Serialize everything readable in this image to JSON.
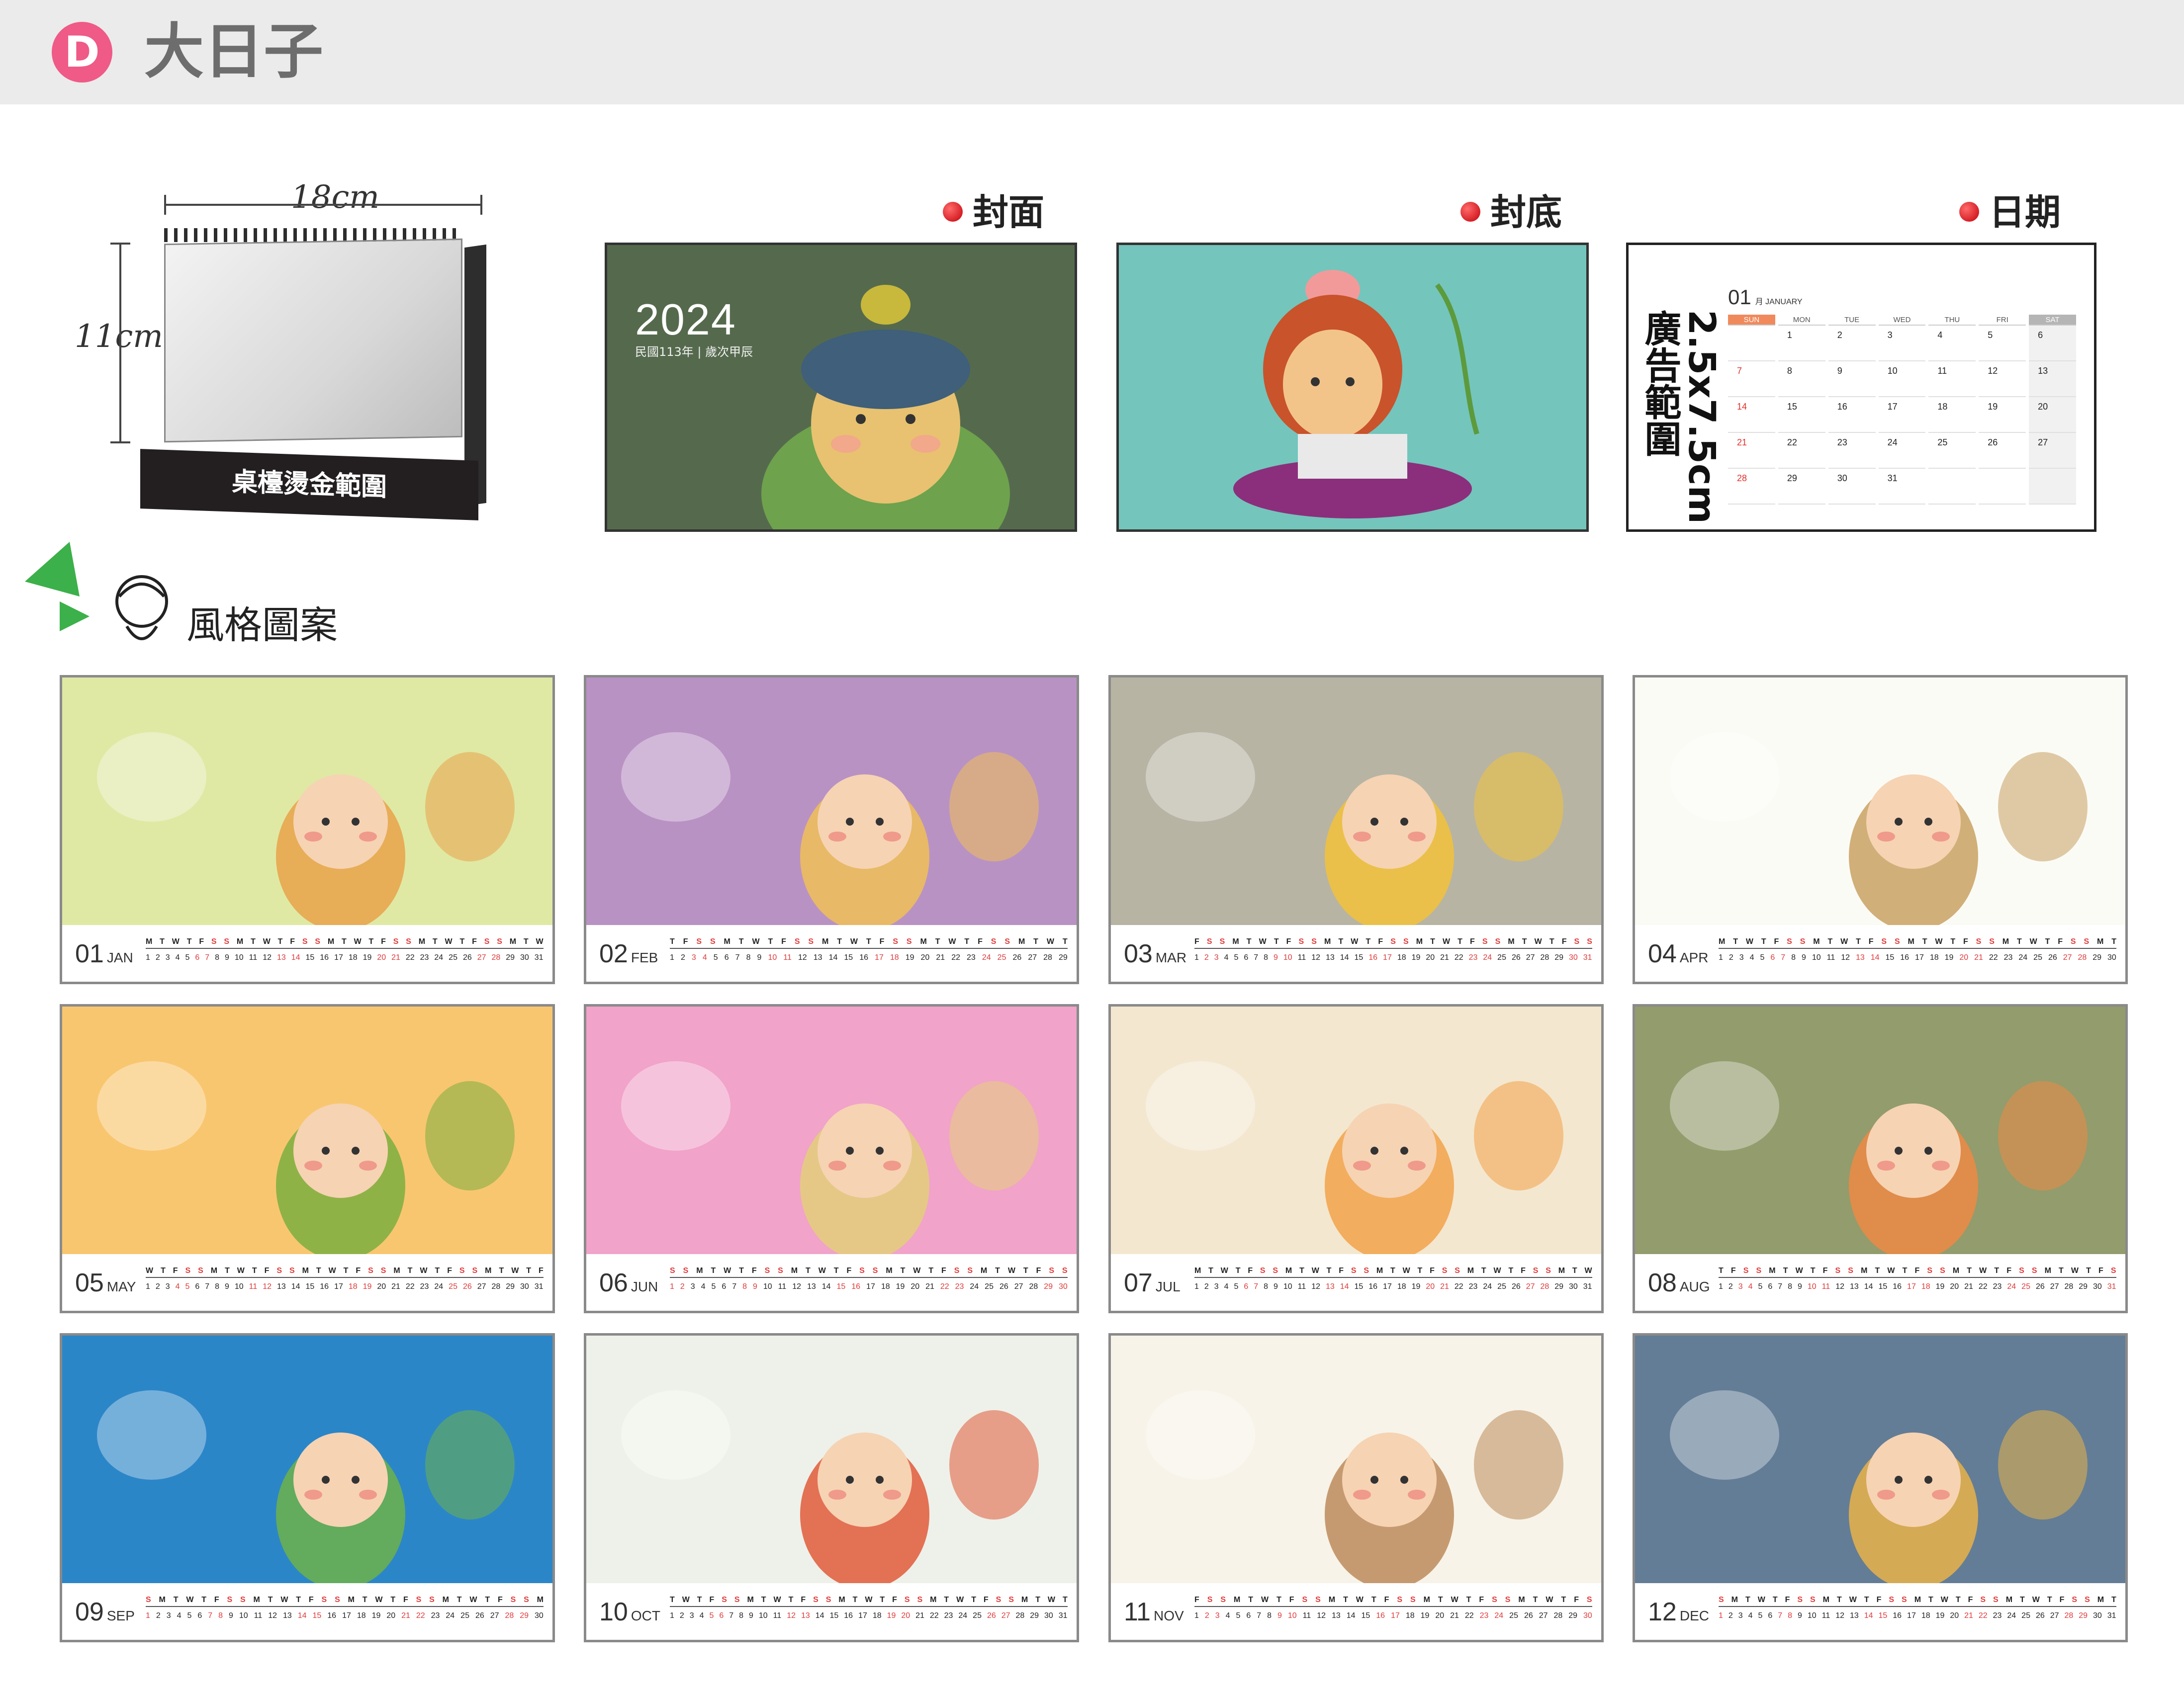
{
  "header": {
    "badge": "D",
    "title": "大日子"
  },
  "desk": {
    "width_label": "18cm",
    "height_label": "11cm",
    "base_label": "桌檯燙金範圍"
  },
  "previews": {
    "cover": {
      "label": "封面",
      "year": "2024",
      "subtitle": "民國113年 | 歲次甲辰",
      "bg": "#556a4d"
    },
    "back": {
      "label": "封底",
      "bg": "#74c5bc"
    },
    "date": {
      "label": "日期",
      "ad_size": "2.5x7.5cm",
      "ad_label": "廣告範圍",
      "month_num": "01",
      "month_name": "月 JANUARY",
      "weekdays": [
        "SUN",
        "MON",
        "TUE",
        "WED",
        "THU",
        "FRI",
        "SAT"
      ],
      "days": [
        "",
        "1",
        "2",
        "3",
        "4",
        "5",
        "6",
        "7",
        "8",
        "9",
        "10",
        "11",
        "12",
        "13",
        "14",
        "15",
        "16",
        "17",
        "18",
        "19",
        "20",
        "21",
        "22",
        "23",
        "24",
        "25",
        "26",
        "27",
        "28",
        "29",
        "30",
        "31",
        "",
        "",
        ""
      ]
    }
  },
  "style": {
    "title": "風格圖案"
  },
  "months": [
    {
      "num": "01",
      "abbr": "JAN",
      "bg": "#dfe9a4",
      "art": "#e9a24a",
      "weekdays": "M T W T F S S M T W T F S S M T W T F S S M T W T F S S M T W",
      "days": "1 2 3 4 5 6 7 8 9 10 11 12 13 14 15 16 17 18 19 20 21 22 23 24 25 26 27 28 29 30 31"
    },
    {
      "num": "02",
      "abbr": "FEB",
      "bg": "#b992c4",
      "art": "#f0c057",
      "weekdays": "T F S S M T W T F S S M T W T F S S M T W T F S S M T W T",
      "days": "1 2 3 4 5 6 7 8 9 10 11 12 13 14 15 16 17 18 19 20 21 22 23 24 25 26 27 28 29"
    },
    {
      "num": "03",
      "abbr": "MAR",
      "bg": "#b7b4a4",
      "art": "#f3c23b",
      "weekdays": "F S S M T W T F S S M T W T F S S M T W T F S S M T W T F S S",
      "days": "1 2 3 4 5 6 7 8 9 10 11 12 13 14 15 16 17 18 19 20 21 22 23 24 25 26 27 28 29 30 31"
    },
    {
      "num": "04",
      "abbr": "APR",
      "bg": "#fbfbf6",
      "art": "#c9a162",
      "weekdays": "M T W T F S S M T W T F S S M T W T F S S M T W T F S S M T",
      "days": "1 2 3 4 5 6 7 8 9 10 11 12 13 14 15 16 17 18 19 20 21 22 23 24 25 26 27 28 29 30"
    },
    {
      "num": "05",
      "abbr": "MAY",
      "bg": "#f9c670",
      "art": "#7cae3f",
      "weekdays": "W T F S S M T W T F S S M T W T F S S M T W T F S S M T W T F",
      "days": "1 2 3 4 5 6 7 8 9 10 11 12 13 14 15 16 17 18 19 20 21 22 23 24 25 26 27 28 29 30 31"
    },
    {
      "num": "06",
      "abbr": "JUN",
      "bg": "#f1a3c9",
      "art": "#e3cf7a",
      "weekdays": "S S M T W T F S S M T W T F S S M T W T F S S M T W T F S S",
      "days": "1 2 3 4 5 6 7 8 9 10 11 12 13 14 15 16 17 18 19 20 21 22 23 24 25 26 27 28 29 30"
    },
    {
      "num": "07",
      "abbr": "JUL",
      "bg": "#f3e7cf",
      "art": "#f2a24a",
      "weekdays": "M T W T F S S M T W T F S S M T W T F S S M T W T F S S M T W",
      "days": "1 2 3 4 5 6 7 8 9 10 11 12 13 14 15 16 17 18 19 20 21 22 23 24 25 26 27 28 29 30 31"
    },
    {
      "num": "08",
      "abbr": "AUG",
      "bg": "#939c6c",
      "art": "#ed8a45",
      "weekdays": "T F S S M T W T F S S M T W T F S S M T W T F S S M T W T F S",
      "days": "1 2 3 4 5 6 7 8 9 10 11 12 13 14 15 16 17 18 19 20 21 22 23 24 25 26 27 28 29 30 31"
    },
    {
      "num": "09",
      "abbr": "SEP",
      "bg": "#2b86c8",
      "art": "#6db24a",
      "weekdays": "S M T W T F S S M T W T F S S M T W T F S S M T W T F S S M",
      "days": "1 2 3 4 5 6 7 8 9 10 11 12 13 14 15 16 17 18 19 20 21 22 23 24 25 26 27 28 29 30"
    },
    {
      "num": "10",
      "abbr": "OCT",
      "bg": "#eef1e9",
      "art": "#e05a3a",
      "weekdays": "T W T F S S M T W T F S S M T W T F S S M T W T F S S M T W T",
      "days": "1 2 3 4 5 6 7 8 9 10 11 12 13 14 15 16 17 18 19 20 21 22 23 24 25 26 27 28 29 30 31"
    },
    {
      "num": "11",
      "abbr": "NOV",
      "bg": "#f7f3e8",
      "art": "#bd8a5a",
      "weekdays": "F S S M T W T F S S M T W T F S S M T W T F S S M T W T F S",
      "days": "1 2 3 4 5 6 7 8 9 10 11 12 13 14 15 16 17 18 19 20 21 22 23 24 25 26 27 28 29 30"
    },
    {
      "num": "12",
      "abbr": "DEC",
      "bg": "#637d96",
      "art": "#e7b24a",
      "weekdays": "S M T W T F S S M T W T F S S M T W T F S S M T W T F S S M T",
      "days": "1 2 3 4 5 6 7 8 9 10 11 12 13 14 15 16 17 18 19 20 21 22 23 24 25 26 27 28 29 30 31"
    }
  ]
}
